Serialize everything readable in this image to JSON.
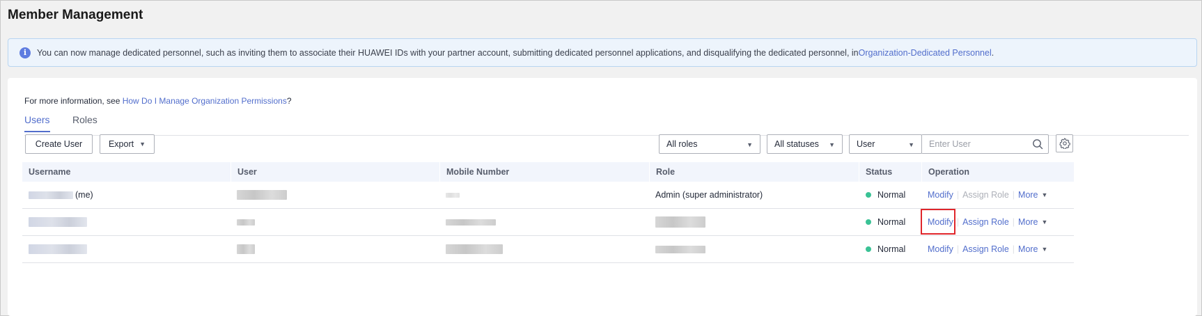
{
  "page": {
    "title": "Member Management"
  },
  "notice": {
    "text": "You can now manage dedicated personnel, such as inviting them to associate their HUAWEI IDs with your partner account, submitting dedicated personnel applications, and disqualifying the dedicated personnel, in ",
    "link": "Organization-Dedicated Personnel",
    "suffix": "."
  },
  "more_info": {
    "prefix": "For more information, see ",
    "link": "How Do I Manage Organization Permissions",
    "suffix": "?"
  },
  "tabs": [
    {
      "label": "Users",
      "active": true
    },
    {
      "label": "Roles",
      "active": false
    }
  ],
  "toolbar": {
    "create_user": "Create User",
    "export": "Export",
    "role_filter": "All roles",
    "status_filter": "All statuses",
    "search_field": "User",
    "search_placeholder": "Enter User"
  },
  "table": {
    "columns": [
      "Username",
      "User",
      "Mobile Number",
      "Role",
      "Status",
      "Operation"
    ],
    "rows": [
      {
        "username_suffix": "(me)",
        "role": "Admin (super administrator)",
        "status": "Normal"
      },
      {
        "username_suffix": "",
        "role": "",
        "status": "Normal"
      },
      {
        "username_suffix": "",
        "role": "",
        "status": "Normal"
      }
    ],
    "operations": {
      "modify": "Modify",
      "assign_role": "Assign Role",
      "more": "More"
    }
  },
  "colors": {
    "accent": "#526ecc",
    "status_normal": "#3ac295",
    "highlight": "#e0262b"
  }
}
